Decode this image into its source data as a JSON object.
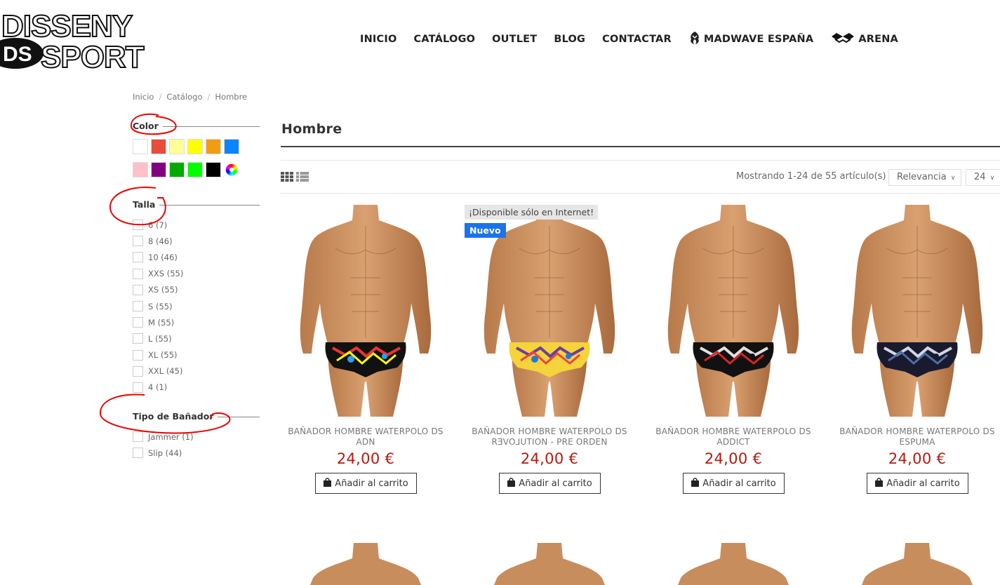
{
  "logo": {
    "line1": "DISSENY",
    "line2": "SPORT",
    "mark": "DS"
  },
  "nav": [
    {
      "label": "INICIO"
    },
    {
      "label": "CATÁLOGO"
    },
    {
      "label": "OUTLET"
    },
    {
      "label": "BLOG"
    },
    {
      "label": "CONTACTAR"
    },
    {
      "label": "MADWAVE ESPAÑA",
      "icon": "madwave-icon"
    },
    {
      "label": "ARENA",
      "icon": "arena-icon"
    }
  ],
  "breadcrumb": [
    "Inicio",
    "Catálogo",
    "Hombre"
  ],
  "filters": {
    "color": {
      "title": "Color",
      "swatches": [
        "#ffffff",
        "#e74c3c",
        "#ffff99",
        "#ffff00",
        "#f39c12",
        "#0a84ff",
        "#ffc0cb",
        "#800080",
        "#00aa00",
        "#00ff00",
        "#000000",
        "multicolor"
      ]
    },
    "talla": {
      "title": "Talla",
      "options": [
        "6 (7)",
        "8 (46)",
        "10 (46)",
        "XXS (55)",
        "XS (55)",
        "S (55)",
        "M (55)",
        "L (55)",
        "XL (55)",
        "XXL (45)",
        "4 (1)"
      ]
    },
    "tipo": {
      "title": "Tipo de Bañador",
      "options": [
        "Jammer (1)",
        "Slip (44)"
      ]
    }
  },
  "main": {
    "title": "Hombre",
    "result_count": "Mostrando 1-24 de 55 artículo(s)",
    "sort_label": "Relevancia",
    "per_page": "24"
  },
  "products": [
    {
      "name": "BAÑADOR HOMBRE WATERPOLO DS ADN",
      "price": "24,00 €",
      "button": "Añadir al carrito",
      "swimsuit_colors": [
        "#111",
        "#e33",
        "#ff0",
        "#2a9df4"
      ]
    },
    {
      "name": "BAÑADOR HOMBRE WATERPOLO DS RƎVO⅃UTION - PRE ORDEN",
      "price": "24,00 €",
      "button": "Añadir al carrito",
      "swimsuit_colors": [
        "#f5d33a",
        "#6b3fa0",
        "#e44",
        "#1c7be0"
      ],
      "badges": [
        "¡Disponible sólo en Internet!",
        "Nuevo"
      ]
    },
    {
      "name": "BAÑADOR HOMBRE WATERPOLO DS ADDICT",
      "price": "24,00 €",
      "button": "Añadir al carrito",
      "swimsuit_colors": [
        "#111",
        "#e0e0e0",
        "#d22",
        "#111"
      ]
    },
    {
      "name": "BAÑADOR HOMBRE WATERPOLO DS ESPUMA",
      "price": "24,00 €",
      "button": "Añadir al carrito",
      "swimsuit_colors": [
        "#1a1a2e",
        "#cfd8e6",
        "#4a6fa5",
        "#1a1a2e"
      ]
    }
  ]
}
